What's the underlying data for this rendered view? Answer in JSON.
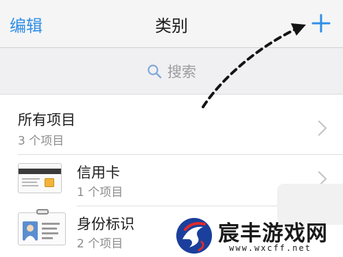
{
  "navbar": {
    "edit_label": "编辑",
    "title": "类别",
    "add_icon": "plus-icon"
  },
  "search": {
    "placeholder": "搜索",
    "icon": "search-icon"
  },
  "list": {
    "items": [
      {
        "title": "所有项目",
        "subtitle": "3 个项目"
      },
      {
        "title": "信用卡",
        "subtitle": "1 个项目",
        "icon": "credit-card-icon"
      },
      {
        "title": "身份标识",
        "subtitle": "2 个项目",
        "icon": "id-card-icon"
      }
    ]
  },
  "watermark": {
    "name": "宸丰游戏网",
    "url": "www.wxcff.net"
  },
  "colors": {
    "accent": "#2f8ee6",
    "navbar_bg": "#f5f5f6",
    "search_bg": "#f0f0f2"
  }
}
